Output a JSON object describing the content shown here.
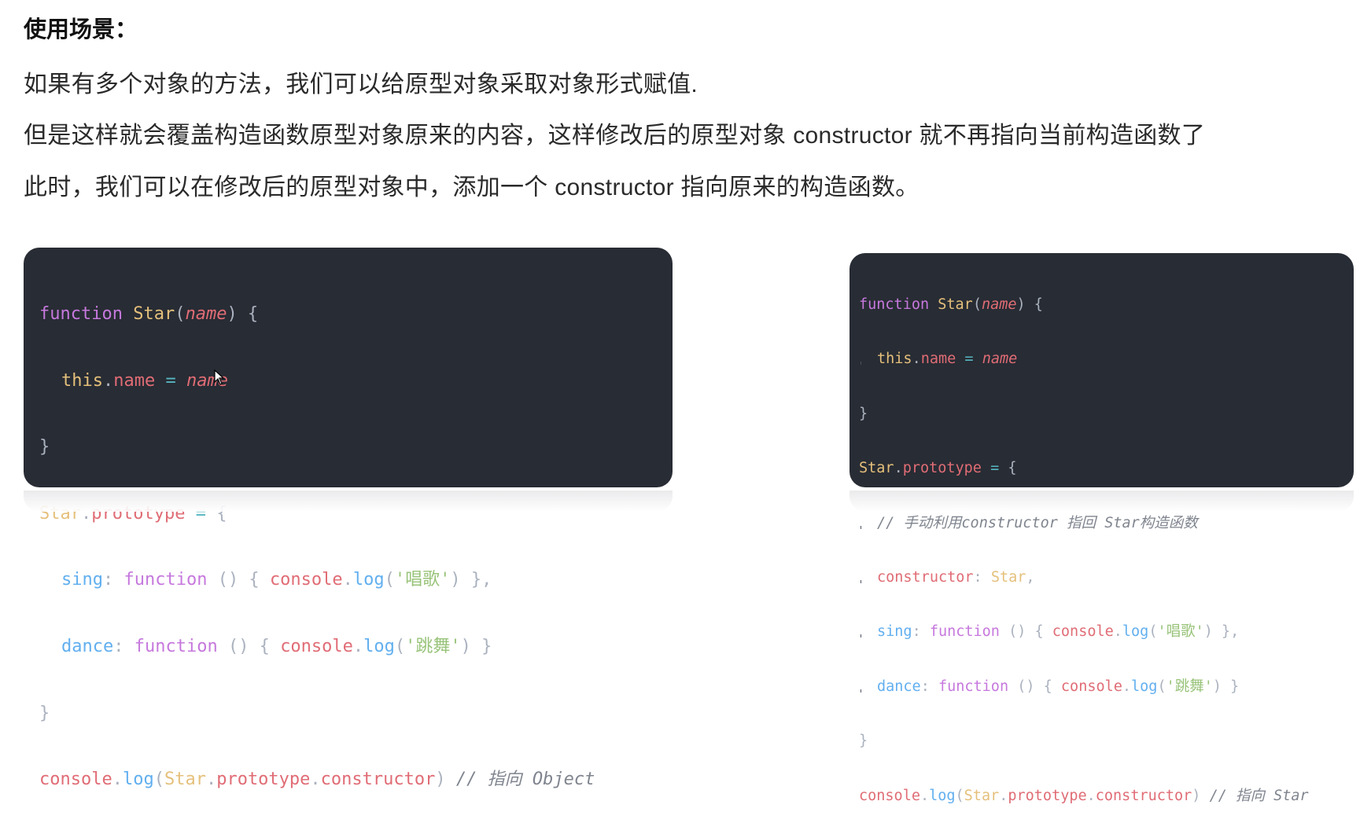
{
  "heading": "使用场景：",
  "paragraphs": [
    "如果有多个对象的方法，我们可以给原型对象采取对象形式赋值.",
    "但是这样就会覆盖构造函数原型对象原来的内容，这样修改后的原型对象 constructor  就不再指向当前构造函数了",
    "此时，我们可以在修改后的原型对象中，添加一个 constructor 指向原来的构造函数。"
  ],
  "left_code": {
    "tokens": {
      "function": "function",
      "Star": "Star",
      "name": "name",
      "this": "this",
      "dot": ".",
      "prototype": "prototype",
      "eq": " = ",
      "sing": "sing",
      "dance": "dance",
      "console": "console",
      "log": "log",
      "str_sing": "'唱歌'",
      "str_dance": "'跳舞'",
      "constructor": "constructor",
      "comment": "// 指向 Object"
    }
  },
  "right_code": {
    "tokens": {
      "comment_manual": "// 手动利用constructor 指回 Star构造函数",
      "constructor": "constructor",
      "comment": "// 指向 Star"
    }
  }
}
